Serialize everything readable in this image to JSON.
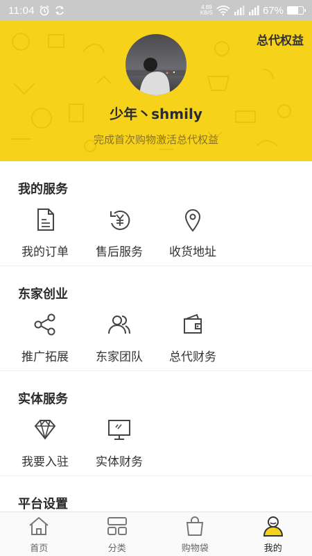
{
  "status_bar": {
    "time": "11:04",
    "speed_value": "4.89",
    "speed_unit": "KB/S",
    "battery": "67%",
    "battery_level": 0.67
  },
  "header": {
    "top_link": "总代权益",
    "username": "少年丶shmily",
    "subtitle": "完成首次购物激活总代权益"
  },
  "sections": [
    {
      "title": "我的服务",
      "items": [
        {
          "label": "我的订单",
          "icon": "order-document-icon"
        },
        {
          "label": "售后服务",
          "icon": "after-sales-yen-icon"
        },
        {
          "label": "收货地址",
          "icon": "location-pin-icon"
        }
      ]
    },
    {
      "title": "东家创业",
      "items": [
        {
          "label": "推广拓展",
          "icon": "share-icon"
        },
        {
          "label": "东家团队",
          "icon": "team-icon"
        },
        {
          "label": "总代财务",
          "icon": "wallet-icon"
        }
      ]
    },
    {
      "title": "实体服务",
      "items": [
        {
          "label": "我要入驻",
          "icon": "diamond-icon"
        },
        {
          "label": "实体财务",
          "icon": "monitor-icon"
        }
      ]
    },
    {
      "title": "平台设置",
      "items": []
    }
  ],
  "bottom_nav": [
    {
      "label": "首页",
      "icon": "home-icon",
      "active": false
    },
    {
      "label": "分类",
      "icon": "category-icon",
      "active": false
    },
    {
      "label": "购物袋",
      "icon": "shopping-bag-icon",
      "active": false
    },
    {
      "label": "我的",
      "icon": "profile-icon",
      "active": true
    }
  ],
  "colors": {
    "accent": "#f7d21b",
    "text": "#333333",
    "status_bar": "#c9c9c9"
  }
}
